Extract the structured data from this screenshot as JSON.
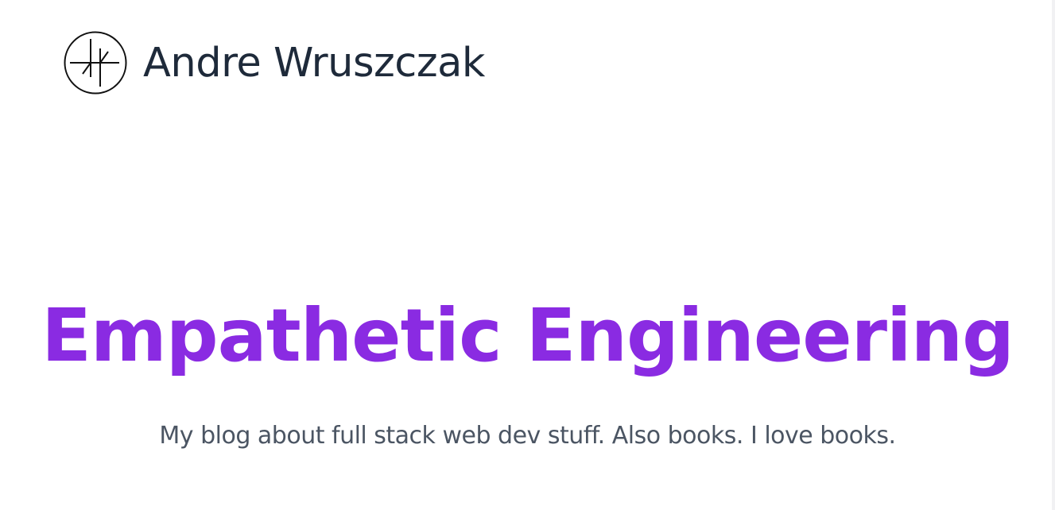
{
  "header": {
    "logo_icon": "monogram-logo-icon",
    "site_name": "Andre Wruszczak"
  },
  "hero": {
    "title": "Empathetic Engineering",
    "subtitle": "My blog about full stack web dev stuff. Also books. I love books."
  },
  "colors": {
    "title": "#8a2be2",
    "site_name": "#1e2a3a",
    "subtitle": "#4b5563",
    "background": "#ffffff"
  }
}
